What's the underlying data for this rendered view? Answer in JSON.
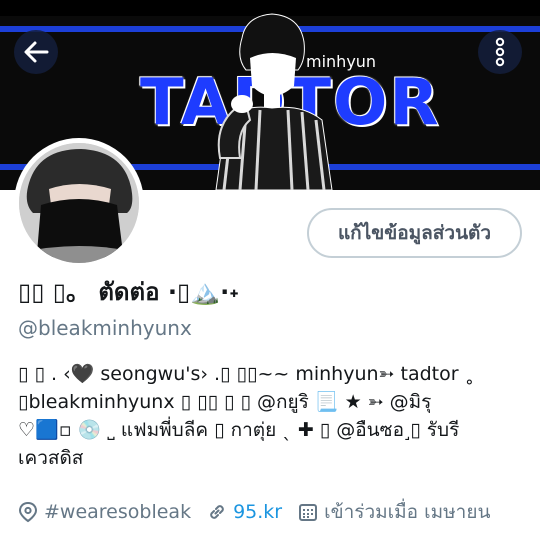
{
  "banner": {
    "wordmark": "TADTOR",
    "small_name": "minhyun"
  },
  "colors": {
    "banner_bg": "#0a0a0a",
    "banner_blue": "#1c3fd8",
    "link": "#1b95e0",
    "muted": "#657786"
  },
  "header": {
    "back_icon": "arrow-left-icon",
    "more_icon": "more-vertical-icon"
  },
  "profile": {
    "edit_button": "แก้ไขข้อมูลส่วนตัว",
    "display_name": "▯▯ ▯。 ตัดต่อ ·▯🏔️·˖",
    "handle": "@bleakminhyunx",
    "bio_lines": [
      "▯ ▯ . ‹🖤 seongwu's› .▯ ▯▯~~ minhyun➳ tadtor ˳",
      "▯bleakminhyunx ▯ ▯▯ ▯ ▯ @กยูริ 📃 ★ ➳  @มิรุ",
      "♡🟦▫ 💿 ˽ แฟมพี่บลีค  ▯ กาตุ่ย ˎ ✚ ▯ @อืนซอ˼▯ รับรี",
      "เควสดิส"
    ],
    "location": "#wearesobleak",
    "website": "95.kr",
    "joined": "เข้าร่วมเมื่อ เมษายน"
  }
}
